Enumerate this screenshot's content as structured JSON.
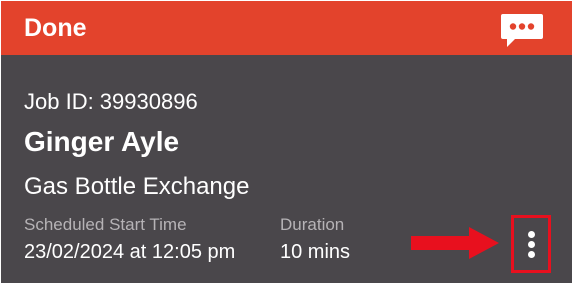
{
  "header": {
    "status": "Done",
    "color": "#e3432c",
    "chat_icon": "chat-bubble-ellipsis-icon"
  },
  "job": {
    "id_text": "Job ID: 39930896",
    "customer_name": "Ginger Ayle",
    "service": "Gas Bottle Exchange",
    "scheduled_label": "Scheduled Start Time",
    "scheduled_value": "23/02/2024 at 12:05 pm",
    "duration_label": "Duration",
    "duration_value": "10 mins"
  },
  "actions": {
    "more_icon": "vertical-ellipsis-icon"
  },
  "annotation": {
    "arrow_color": "#e8101e",
    "highlight_color": "#e8101e"
  },
  "colors": {
    "card_background": "#4a474b",
    "secondary_text": "#b6b3b6"
  }
}
